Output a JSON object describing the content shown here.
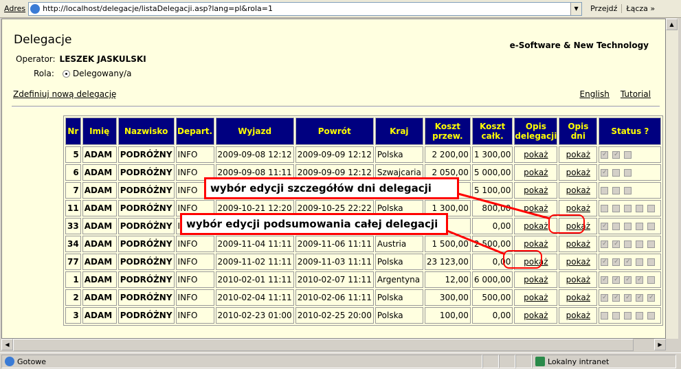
{
  "browser": {
    "address_label": "Adres",
    "url": "http://localhost/delegacje/listaDelegacji.asp?lang=pl&rola=1",
    "go_label": "Przejdź",
    "links_label": "Łącza »",
    "status_text": "Gotowe",
    "zone_text": "Lokalny intranet"
  },
  "page": {
    "title": "Delegacje",
    "brand": "e-Software & New Technology",
    "operator_label": "Operator:",
    "operator_name": "LESZEK JASKULSKI",
    "role_label": "Rola:",
    "role_value": "Delegowany/a",
    "new_link": "Zdefiniuj nową delegację",
    "lang_link": "English",
    "tutorial_link": "Tutorial"
  },
  "table": {
    "headers": [
      "Nr",
      "Imię",
      "Nazwisko",
      "Depart.",
      "Wyjazd",
      "Powrót",
      "Kraj",
      "Koszt przew.",
      "Koszt całk.",
      "Opis delegacji",
      "Opis dni",
      "Status ?"
    ],
    "rows": [
      {
        "nr": "5",
        "imie": "ADAM",
        "nazwisko": "PODRÓŻNY",
        "dep": "INFO",
        "wyjazd": "2009-09-08 12:12",
        "powrot": "2009-09-09 12:12",
        "kraj": "Polska",
        "przew": "2 200,00",
        "calk": "1 300,00",
        "opis": "pokaż",
        "dni": "pokaż",
        "status": [
          true,
          true,
          false
        ]
      },
      {
        "nr": "6",
        "imie": "ADAM",
        "nazwisko": "PODRÓŻNY",
        "dep": "INFO",
        "wyjazd": "2009-09-08 11:11",
        "powrot": "2009-09-09 12:12",
        "kraj": "Szwajcaria",
        "przew": "2 050,00",
        "calk": "5 000,00",
        "opis": "pokaż",
        "dni": "pokaż",
        "status": [
          true,
          false,
          false
        ]
      },
      {
        "nr": "7",
        "imie": "ADAM",
        "nazwisko": "PODRÓŻNY",
        "dep": "INFO",
        "wyjazd": "",
        "powrot": "",
        "kraj": "",
        "przew": "",
        "calk": "5 100,00",
        "opis": "pokaż",
        "dni": "pokaż",
        "status": [
          false,
          false,
          false
        ]
      },
      {
        "nr": "11",
        "imie": "ADAM",
        "nazwisko": "PODRÓŻNY",
        "dep": "INFO",
        "wyjazd": "2009-10-21 12:20",
        "powrot": "2009-10-25 22:22",
        "kraj": "Polska",
        "przew": "1 300,00",
        "calk": "800,00",
        "opis": "pokaż",
        "dni": "pokaż",
        "status": [
          false,
          false,
          false,
          false,
          false
        ]
      },
      {
        "nr": "33",
        "imie": "ADAM",
        "nazwisko": "PODRÓŻNY",
        "dep": "INFO",
        "wyjazd": "",
        "powrot": "",
        "kraj": "",
        "przew": "",
        "calk": "0,00",
        "opis": "pokaż",
        "dni": "pokaż",
        "status": [
          true,
          false,
          false,
          false,
          false
        ]
      },
      {
        "nr": "34",
        "imie": "ADAM",
        "nazwisko": "PODRÓŻNY",
        "dep": "INFO",
        "wyjazd": "2009-11-04 11:11",
        "powrot": "2009-11-06 11:11",
        "kraj": "Austria",
        "przew": "1 500,00",
        "calk": "2 500,00",
        "opis": "pokaż",
        "dni": "pokaż",
        "status": [
          true,
          true,
          false,
          false,
          false
        ]
      },
      {
        "nr": "77",
        "imie": "ADAM",
        "nazwisko": "PODRÓŻNY",
        "dep": "INFO",
        "wyjazd": "2009-11-02 11:11",
        "powrot": "2009-11-03 11:11",
        "kraj": "Polska",
        "przew": "23 123,00",
        "calk": "0,00",
        "opis": "pokaż",
        "dni": "pokaż",
        "status": [
          true,
          true,
          true,
          false,
          false
        ]
      },
      {
        "nr": "1",
        "imie": "ADAM",
        "nazwisko": "PODRÓŻNY",
        "dep": "INFO",
        "wyjazd": "2010-02-01 11:11",
        "powrot": "2010-02-07 11:11",
        "kraj": "Argentyna",
        "przew": "12,00",
        "calk": "6 000,00",
        "opis": "pokaż",
        "dni": "pokaż",
        "status": [
          true,
          true,
          true,
          true,
          false
        ]
      },
      {
        "nr": "2",
        "imie": "ADAM",
        "nazwisko": "PODRÓŻNY",
        "dep": "INFO",
        "wyjazd": "2010-02-04 11:11",
        "powrot": "2010-02-06 11:11",
        "kraj": "Polska",
        "przew": "300,00",
        "calk": "500,00",
        "opis": "pokaż",
        "dni": "pokaż",
        "status": [
          true,
          true,
          true,
          true,
          true
        ]
      },
      {
        "nr": "3",
        "imie": "ADAM",
        "nazwisko": "PODRÓŻNY",
        "dep": "INFO",
        "wyjazd": "2010-02-23 01:00",
        "powrot": "2010-02-25 20:00",
        "kraj": "Polska",
        "przew": "100,00",
        "calk": "0,00",
        "opis": "pokaż",
        "dni": "pokaż",
        "status": [
          false,
          false,
          false,
          false,
          false
        ]
      }
    ]
  },
  "annotations": {
    "days": "wybór edycji szczegółów dni delegacji",
    "summary": "wybór edycji podsumowania całej delegacji"
  },
  "colors": {
    "header_bg": "#000080",
    "header_text": "#ffff00",
    "page_bg": "#ffffe0",
    "annotation": "#ff0000"
  }
}
